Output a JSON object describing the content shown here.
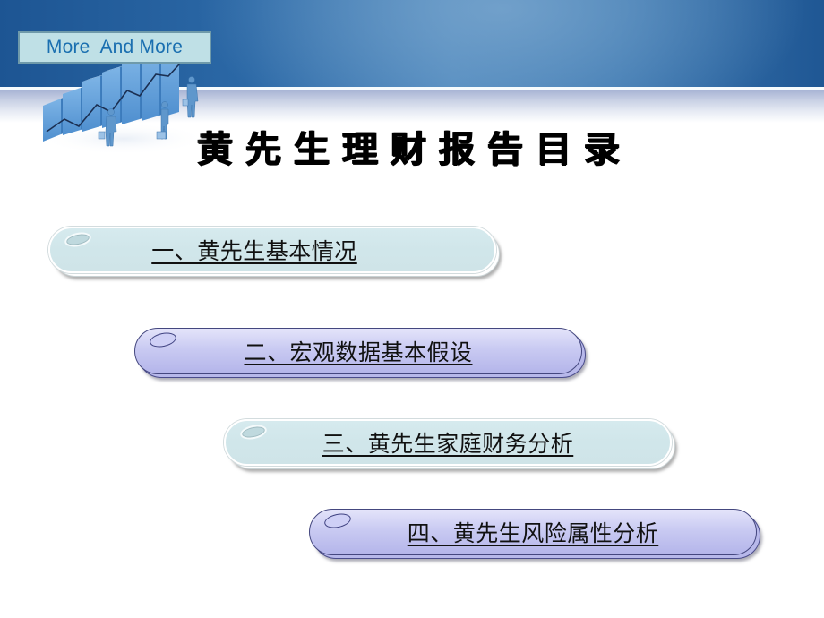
{
  "slide": {
    "tagline": "More  And More",
    "title": "黄先生理财报告目录",
    "illustration": "business-growth-chart-with-figures",
    "menu": [
      {
        "label": "一、黄先生基本情况",
        "style": "teal"
      },
      {
        "label": "二、宏观数据基本假设",
        "style": "violet"
      },
      {
        "label": "三、黄先生家庭财务分析",
        "style": "teal"
      },
      {
        "label": "四、黄先生风险属性分析",
        "style": "violet"
      }
    ]
  },
  "colors": {
    "header_blue": "#1d5593",
    "tagline_bg": "#bfe0e6",
    "tagline_text": "#1a6fb0",
    "teal_pill": "#d0e6ea",
    "violet_pill": "#c9caf2",
    "violet_border": "#44477f"
  }
}
